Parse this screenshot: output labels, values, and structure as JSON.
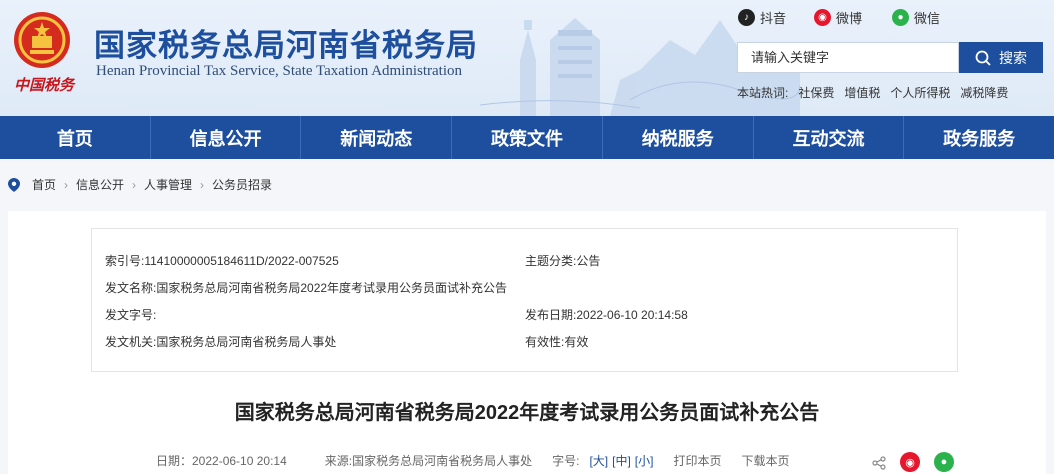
{
  "header": {
    "brand_cn": "国家税务总局河南省税务局",
    "brand_en": "Henan Provincial Tax Service, State Taxation Administration",
    "china_tax": "中国税务",
    "social": [
      {
        "label": "抖音",
        "icon": "douyin-icon",
        "color": "#222222"
      },
      {
        "label": "微博",
        "icon": "weibo-icon",
        "color": "#e6162d"
      },
      {
        "label": "微信",
        "icon": "wechat-icon",
        "color": "#2bb24c"
      }
    ],
    "search": {
      "placeholder": "请输入关键字",
      "button": "搜索"
    },
    "hotwords": {
      "label": "本站热词:",
      "items": [
        "社保费",
        "增值税",
        "个人所得税",
        "减税降费"
      ]
    }
  },
  "nav": [
    "首页",
    "信息公开",
    "新闻动态",
    "政策文件",
    "纳税服务",
    "互动交流",
    "政务服务"
  ],
  "breadcrumb": [
    "首页",
    "信息公开",
    "人事管理",
    "公务员招录"
  ],
  "meta": {
    "index_label": "索引号:",
    "index_value": "11410000005184611D/2022-007525",
    "topic_label": "主题分类:",
    "topic_value": "公告",
    "name_label": "发文名称:",
    "name_value": "国家税务总局河南省税务局2022年度考试录用公务员面试补充公告",
    "docno_label": "发文字号:",
    "docno_value": "",
    "date_label": "发布日期:",
    "date_value": "2022-06-10 20:14:58",
    "org_label": "发文机关:",
    "org_value": "国家税务总局河南省税务局人事处",
    "valid_label": "有效性:",
    "valid_value": "有效"
  },
  "article": {
    "title": "国家税务总局河南省税务局2022年度考试录用公务员面试补充公告",
    "date": "日期：2022-06-10 20:14",
    "source": "来源:国家税务总局河南省税务局人事处",
    "font_label": "字号:",
    "font_large": "[大]",
    "font_medium": "[中]",
    "font_small": "[小]",
    "print": "打印本页",
    "download": "下载本页"
  },
  "colors": {
    "primary": "#1d4f9e",
    "header_bg": "#e9f1fb",
    "weibo": "#e6162d",
    "wechat": "#2bb24c"
  }
}
